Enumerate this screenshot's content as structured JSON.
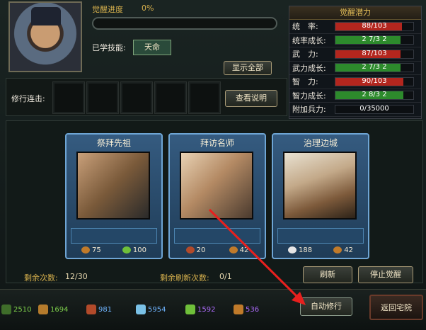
{
  "awaken": {
    "progress_label": "觉醒进度",
    "progress_value": "0%",
    "learned_label": "已学技能:",
    "skill_name": "天命",
    "show_all": "显示全部"
  },
  "practice": {
    "combo_label": "修行连击:",
    "view_desc": "查看说明"
  },
  "potential": {
    "title": "觉醒潜力",
    "rows": [
      {
        "label": "统　率:",
        "value": "88/103",
        "fill": 0.85,
        "color": "#b3261e"
      },
      {
        "label": "统率成长:",
        "value": "2 7/3 2",
        "fill": 0.84,
        "color": "#2d8a2c"
      },
      {
        "label": "武　力:",
        "value": "87/103",
        "fill": 0.84,
        "color": "#b3261e"
      },
      {
        "label": "武力成长:",
        "value": "2 7/3 2",
        "fill": 0.84,
        "color": "#2d8a2c"
      },
      {
        "label": "智　力:",
        "value": "90/103",
        "fill": 0.87,
        "color": "#b3261e"
      },
      {
        "label": "智力成长:",
        "value": "2 8/3 2",
        "fill": 0.87,
        "color": "#2d8a2c"
      },
      {
        "label": "附加兵力:",
        "value": "0/35000",
        "fill": 0.0,
        "color": "#2d8a2c"
      }
    ]
  },
  "cards": [
    {
      "title": "祭拜先祖",
      "cost1": "75",
      "cost2": "100",
      "c1": "#c07a2a",
      "c2": "#6fbf3a"
    },
    {
      "title": "拜访名师",
      "cost1": "20",
      "cost2": "42",
      "c1": "#b24a2a",
      "c2": "#c07a2a"
    },
    {
      "title": "治理边城",
      "cost1": "188",
      "cost2": "42",
      "c1": "#e5e5e5",
      "c2": "#c07a2a"
    }
  ],
  "counters": {
    "remaining_label": "剩余次数:",
    "remaining_value": "12/30",
    "refresh_label": "剩余刷新次数:",
    "refresh_value": "0/1"
  },
  "buttons": {
    "refresh": "刷新",
    "stop": "停止觉醒",
    "auto": "自动修行",
    "back": "返回宅院"
  },
  "resources": [
    {
      "value": "2510",
      "color": "#7ed04b",
      "icon": "#3f6d2a"
    },
    {
      "value": "1694",
      "color": "#7ed04b",
      "icon": "#b57b2c"
    },
    {
      "value": "981",
      "color": "#6fb4ff",
      "icon": "#b24a2a"
    },
    {
      "value": "5954",
      "color": "#6fb4ff",
      "icon": "#7ac1e6"
    },
    {
      "value": "1592",
      "color": "#b06cff",
      "icon": "#6fbf3a"
    },
    {
      "value": "536",
      "color": "#b06cff",
      "icon": "#c07a2a"
    }
  ]
}
